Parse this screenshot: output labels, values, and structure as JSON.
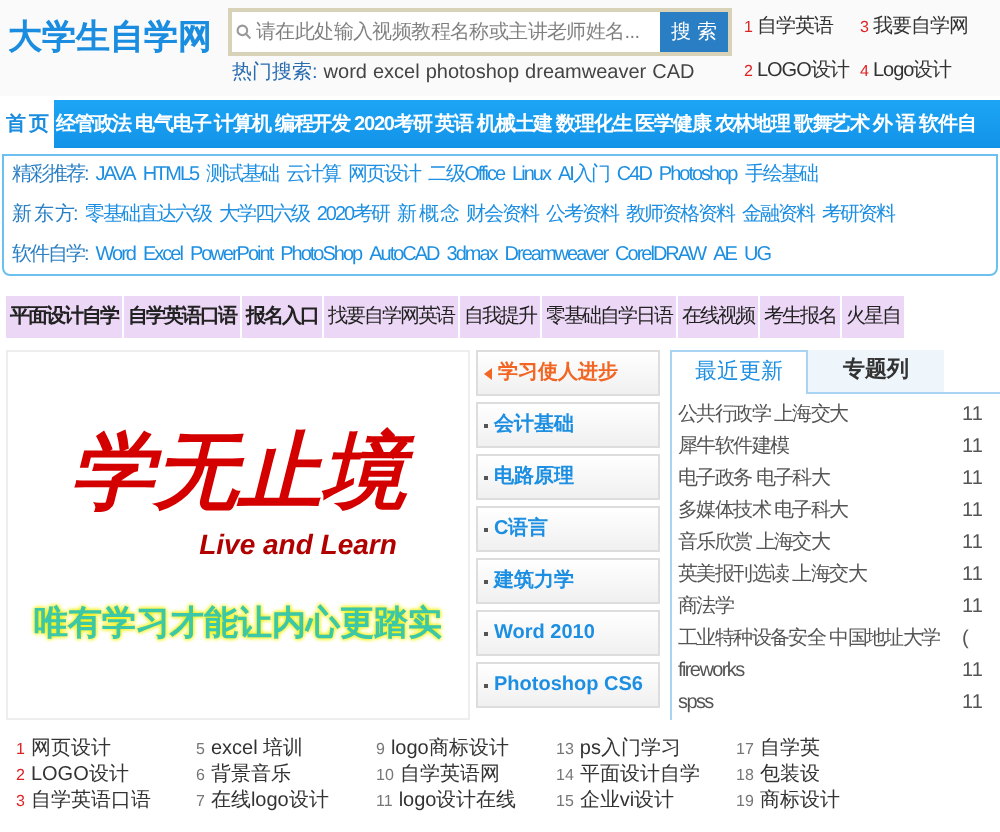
{
  "logo": "大学生自学网",
  "search": {
    "placeholder": "请在此处输入视频教程名称或主讲老师姓名...",
    "button": "搜 索"
  },
  "hot_search": {
    "label": "热门搜索:",
    "terms": [
      "word",
      "excel",
      "photoshop",
      "dreamweaver",
      "CAD"
    ]
  },
  "top_list": [
    {
      "rank": "1",
      "text": "自学英语"
    },
    {
      "rank": "3",
      "text": "我要自学网"
    },
    {
      "rank": "2",
      "text": "LOGO设计"
    },
    {
      "rank": "4",
      "text": "Logo设计"
    }
  ],
  "nav": [
    {
      "label": "首 页",
      "selected": true
    },
    {
      "label": "经管政法",
      "selected": false
    },
    {
      "label": "电气电子",
      "selected": false
    },
    {
      "label": "计算机",
      "selected": false
    },
    {
      "label": "编程开发",
      "selected": false
    },
    {
      "label": "2020考研",
      "selected": false
    },
    {
      "label": "英语",
      "selected": false
    },
    {
      "label": "机械土建",
      "selected": false
    },
    {
      "label": "数理化生",
      "selected": false
    },
    {
      "label": "医学健康",
      "selected": false
    },
    {
      "label": "农林地理",
      "selected": false
    },
    {
      "label": "歌舞艺术",
      "selected": false
    },
    {
      "label": "外 语",
      "selected": false
    },
    {
      "label": "软件自",
      "selected": false
    }
  ],
  "recommend": [
    {
      "label": "精彩推荐:",
      "links": [
        "JAVA",
        "HTML5",
        "测试基础",
        "云计算",
        "网页设计",
        "二级Office",
        "Linux",
        "AI入门",
        "C4D",
        "Photoshop",
        "手绘基础"
      ]
    },
    {
      "label": "新 东 方:",
      "links": [
        "零基础直达六级",
        "大学四六级",
        "2020考研",
        "新 概 念",
        "财会资料",
        "公考资料",
        "教师资格资料",
        "金融资料",
        "考研资料"
      ]
    },
    {
      "label": "软件自学:",
      "links": [
        "Word",
        "Excel",
        "PowerPoint",
        "PhotoShop",
        "AutoCAD",
        "3dmax",
        "Dreamweaver",
        "CorelDRAW",
        "AE",
        "UG"
      ]
    }
  ],
  "tag_bar": [
    {
      "label": "平面设计自学",
      "bold": true
    },
    {
      "label": "自学英语口语",
      "bold": true
    },
    {
      "label": "报名入口",
      "bold": true
    },
    {
      "label": "找要自学网英语",
      "bold": false
    },
    {
      "label": "自我提升",
      "bold": false
    },
    {
      "label": "零基础自学日语",
      "bold": false
    },
    {
      "label": "在线视频",
      "bold": false
    },
    {
      "label": "考生报名",
      "bold": false
    },
    {
      "label": "火星自",
      "bold": false
    }
  ],
  "banner": {
    "title": "学无止境",
    "subtitle": "Live and Learn",
    "slogan": "唯有学习才能让内心更踏实"
  },
  "side_menu": [
    {
      "label": "学习使人进步",
      "selected": true
    },
    {
      "label": "会计基础",
      "selected": false
    },
    {
      "label": "电路原理",
      "selected": false
    },
    {
      "label": "C语言",
      "selected": false
    },
    {
      "label": "建筑力学",
      "selected": false
    },
    {
      "label": "Word 2010",
      "selected": false
    },
    {
      "label": "Photoshop CS6",
      "selected": false
    }
  ],
  "update_tabs": [
    {
      "label": "最近更新",
      "selected": true
    },
    {
      "label": "专题列",
      "selected": false
    }
  ],
  "updates": [
    {
      "title": "公共行政学 上海交大",
      "date": "11"
    },
    {
      "title": "犀牛软件建模",
      "date": "11"
    },
    {
      "title": "电子政务 电子科大",
      "date": "11"
    },
    {
      "title": "多媒体技术 电子科大",
      "date": "11"
    },
    {
      "title": "音乐欣赏 上海交大",
      "date": "11"
    },
    {
      "title": "英美报刊选读 上海交大",
      "date": "11"
    },
    {
      "title": "商法学",
      "date": "11"
    },
    {
      "title": "工业特种设备安全 中国地址大学",
      "date": "("
    },
    {
      "title": "fireworks",
      "date": "11"
    },
    {
      "title": "spss",
      "date": "11"
    }
  ],
  "ranking": [
    [
      {
        "rank": "1",
        "text": "网页设计",
        "hot": true
      },
      {
        "rank": "2",
        "text": "LOGO设计",
        "hot": true
      },
      {
        "rank": "3",
        "text": "自学英语口语",
        "hot": true
      }
    ],
    [
      {
        "rank": "5",
        "text": "excel 培训",
        "hot": false
      },
      {
        "rank": "6",
        "text": "背景音乐",
        "hot": false
      },
      {
        "rank": "7",
        "text": "在线logo设计",
        "hot": false
      }
    ],
    [
      {
        "rank": "9",
        "text": "logo商标设计",
        "hot": false
      },
      {
        "rank": "10",
        "text": "自学英语网",
        "hot": false
      },
      {
        "rank": "11",
        "text": "logo设计在线",
        "hot": false
      }
    ],
    [
      {
        "rank": "13",
        "text": "ps入门学习",
        "hot": false
      },
      {
        "rank": "14",
        "text": "平面设计自学",
        "hot": false
      },
      {
        "rank": "15",
        "text": "企业vi设计",
        "hot": false
      }
    ],
    [
      {
        "rank": "17",
        "text": "自学英",
        "hot": false
      },
      {
        "rank": "18",
        "text": "包装设",
        "hot": false
      },
      {
        "rank": "19",
        "text": "商标设计",
        "hot": false
      }
    ]
  ]
}
